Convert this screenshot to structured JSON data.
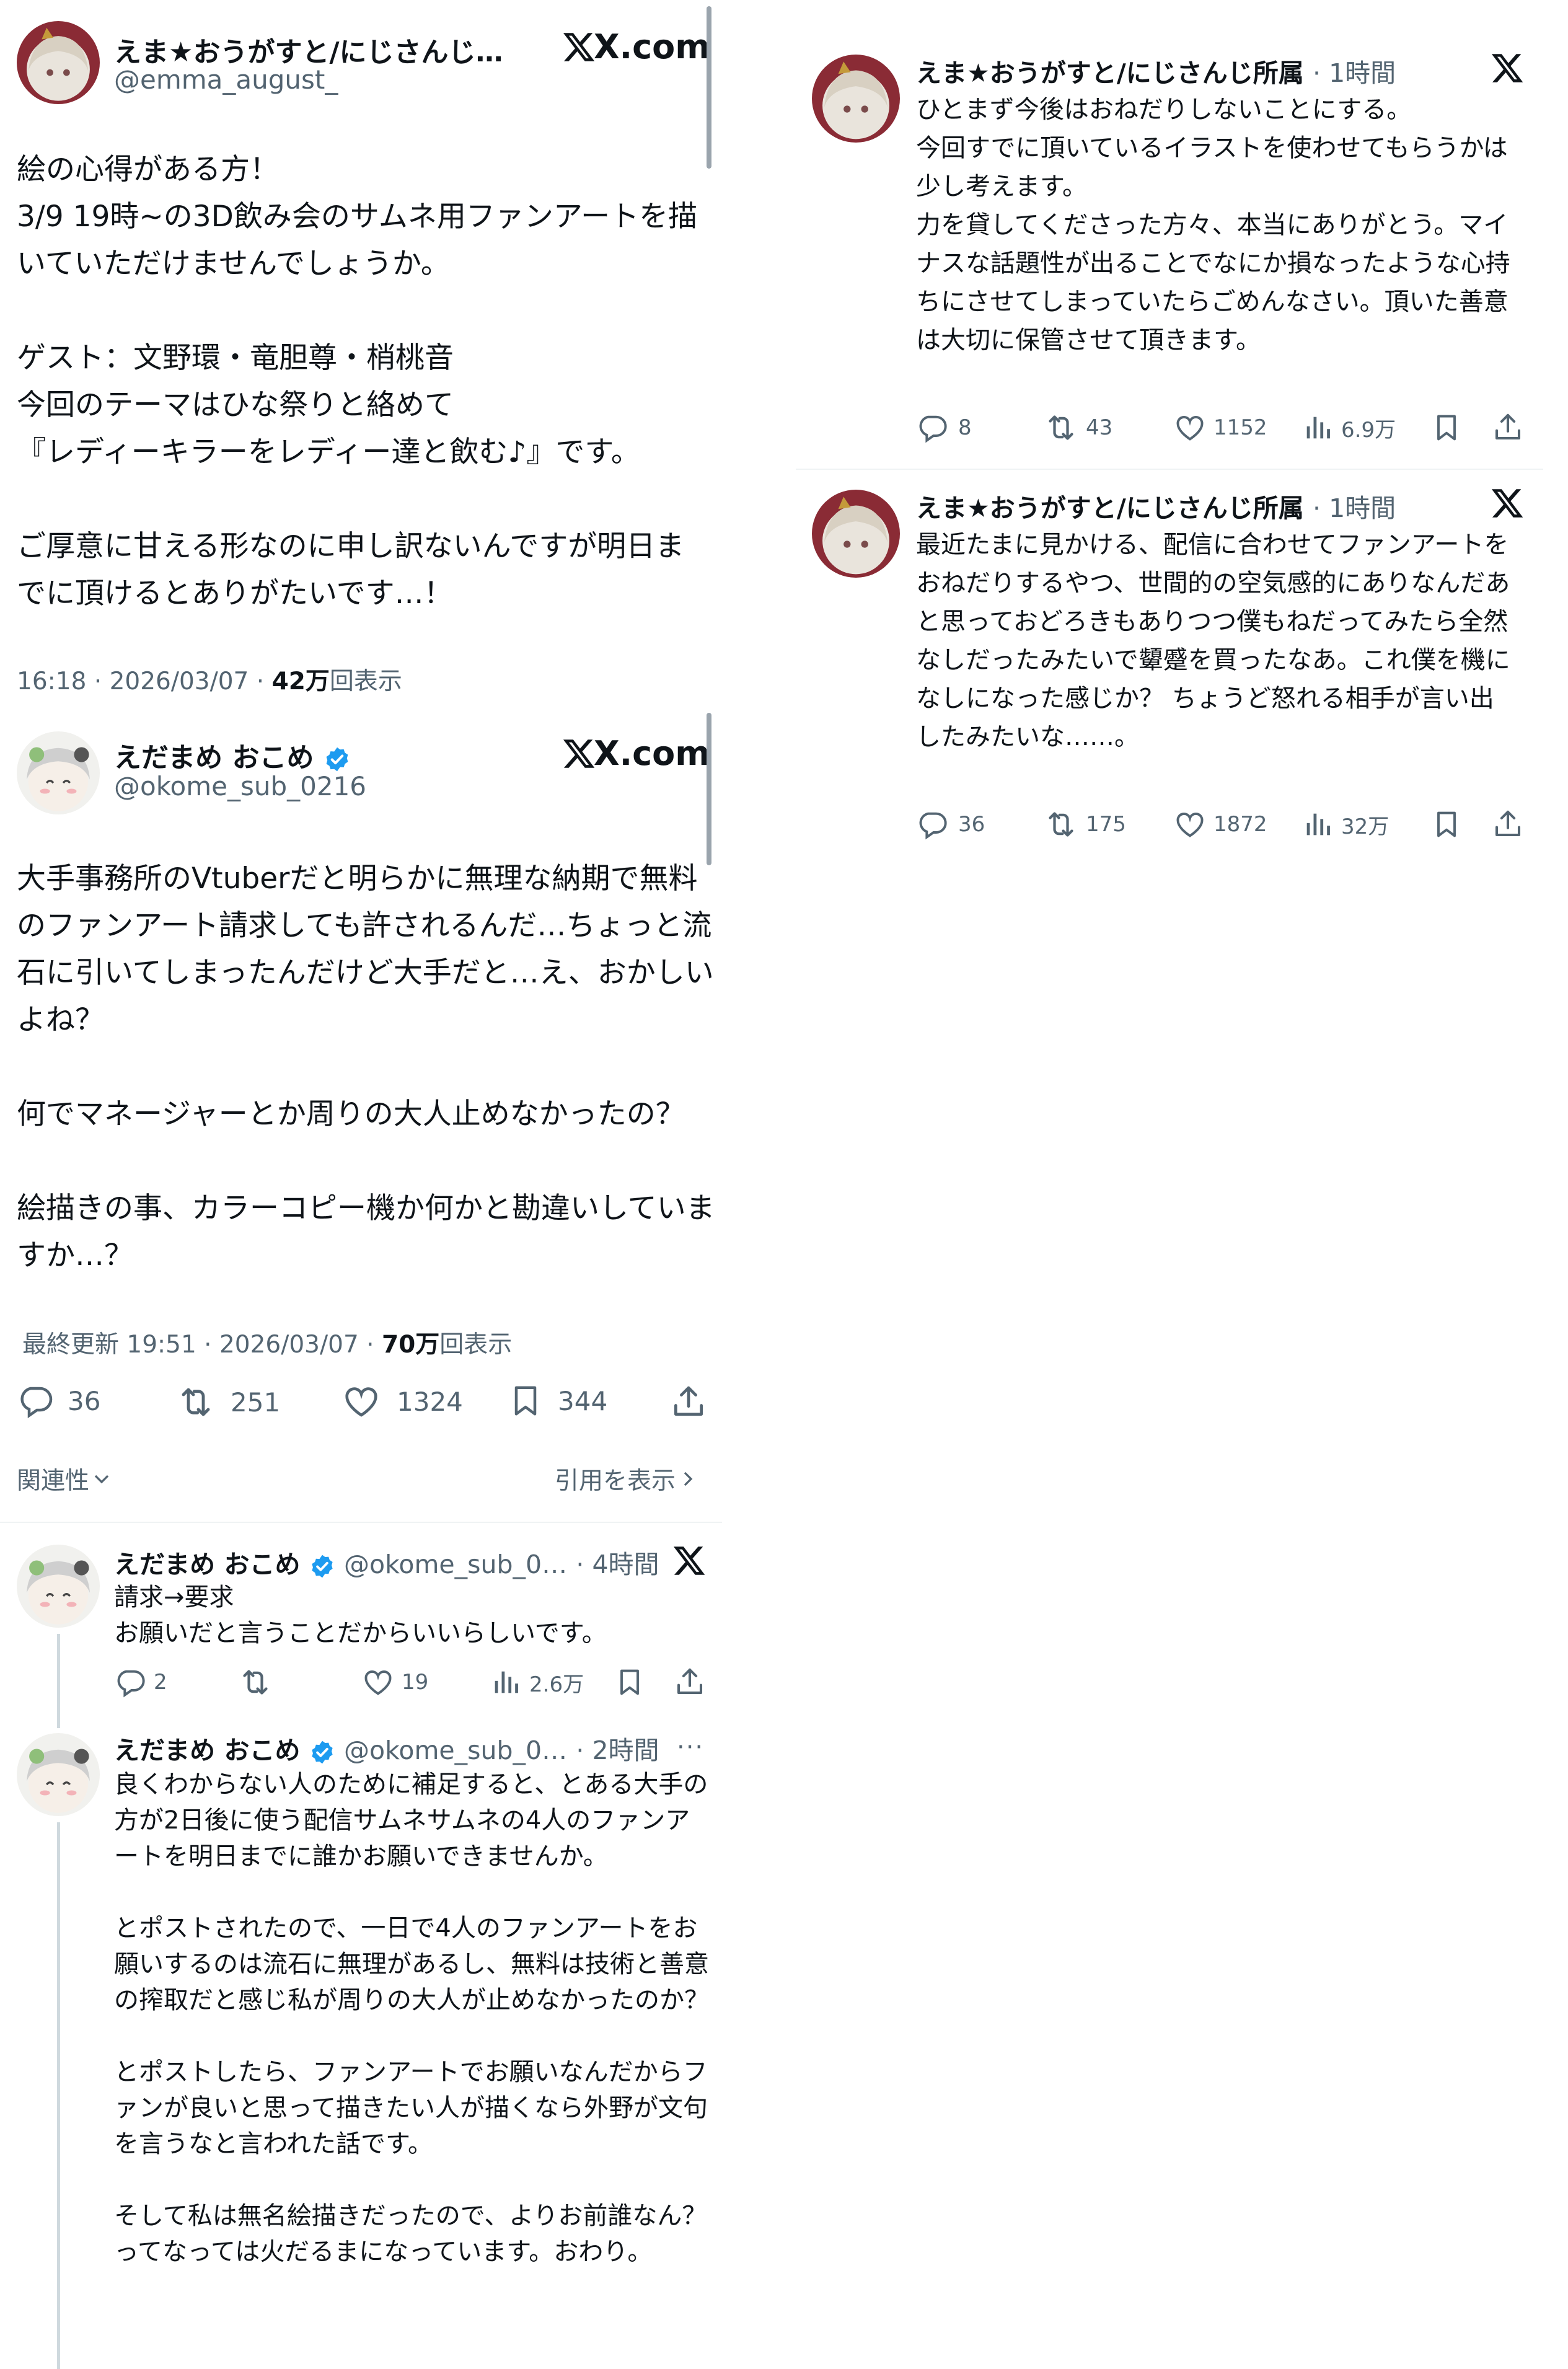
{
  "left": {
    "post1": {
      "name": "えま★おうがすと/にじさんじ…",
      "handle": "@emma_august_",
      "brand": "X.com",
      "text": "絵の心得がある方！\n3/9 19時~の3D飲み会のサムネ用ファンアートを描いていただけませんでしょうか。\n\nゲスト：文野環・竜胆尊・梢桃音\n今回のテーマはひな祭りと絡めて\n『レディーキラーをレディー達と飲む♪』です。\n\nご厚意に甘える形なのに申し訳ないんですが明日までに頂けるとありがたいです…！",
      "meta_prefix": "16:18 · 2026/03/07 · ",
      "views": "42万",
      "views_suffix": "回表示"
    },
    "post2": {
      "name": "えだまめ おこめ",
      "handle": "@okome_sub_0216",
      "brand": "X.com",
      "text": "大手事務所のVtuberだと明らかに無理な納期で無料のファンアート請求しても許されるんだ…ちょっと流石に引いてしまったんだけど大手だと…え、おかしいよね？\n\n何でマネージャーとか周りの大人止めなかったの？\n\n絵描きの事、カラーコピー機か何かと勘違いしていますか…？",
      "meta_prefix": "最終更新 19:51 · 2026/03/07 · ",
      "views": "70万",
      "views_suffix": "回表示",
      "replies": "36",
      "reposts": "251",
      "likes": "1324",
      "bookmarks": "344",
      "sort_label": "関連性",
      "quotes_label": "引用を表示"
    },
    "reply1": {
      "name": "えだまめ おこめ",
      "handle": "@okome_sub_0…",
      "time": "· 4時間",
      "text": "請求→要求\nお願いだと言うことだからいいらしいです。",
      "replies": "2",
      "reposts": "",
      "likes": "19",
      "views": "2.6万"
    },
    "reply2": {
      "name": "えだまめ おこめ",
      "handle": "@okome_sub_0…",
      "time": "· 2時間",
      "text": "良くわからない人のために補足すると、とある大手の方が2日後に使う配信サムネサムネの4人のファンアートを明日までに誰かお願いできませんか。\n\nとポストされたので、一日で4人のファンアートをお願いするのは流石に無理があるし、無料は技術と善意の搾取だと感じ私が周りの大人が止めなかったのか？\n\nとポストしたら、ファンアートでお願いなんだからファンが良いと思って描きたい人が描くなら外野が文句を言うなと言われた話です。\n\nそして私は無名絵描きだったので、よりお前誰なん？ってなっては火だるまになっています。おわり。"
    }
  },
  "right": {
    "post1": {
      "name": "えま★おうがすと/にじさんじ所属",
      "time": "· 1時間",
      "text": "ひとまず今後はおねだりしないことにする。\n今回すでに頂いているイラストを使わせてもらうかは少し考えます。\n力を貸してくださった方々、本当にありがとう。マイナスな話題性が出ることでなにか損なったような心持ちにさせてしまっていたらごめんなさい。頂いた善意は大切に保管させて頂きます。",
      "replies": "8",
      "reposts": "43",
      "likes": "1152",
      "views": "6.9万"
    },
    "post2": {
      "name": "えま★おうがすと/にじさんじ所属",
      "time": "· 1時間",
      "text": "最近たまに見かける、配信に合わせてファンアートをおねだりするやつ、世間的の空気感的にありなんだあと思っておどろきもありつつ僕もねだってみたら全然なしだったみたいで顰蹙を買ったなあ。これ僕を機になしになった感じか？ ちょうど怒れる相手が言い出したみたいな……。",
      "replies": "36",
      "reposts": "175",
      "likes": "1872",
      "views": "32万"
    }
  },
  "colors": {
    "text": "#0f1419",
    "muted": "#536471",
    "verified": "#1d9bf0",
    "divider": "#eff3f4"
  },
  "icons": [
    "x-logo-icon",
    "verified-badge-icon",
    "reply-icon",
    "repost-icon",
    "like-icon",
    "bookmark-icon",
    "share-icon",
    "views-icon",
    "chevron-down-icon",
    "chevron-right-icon",
    "more-icon"
  ]
}
